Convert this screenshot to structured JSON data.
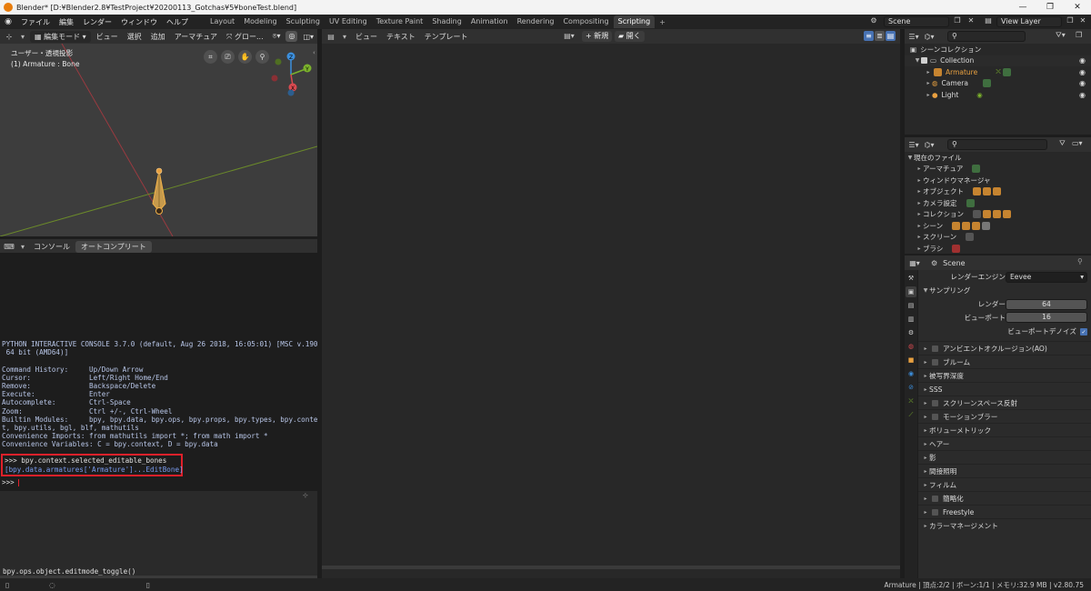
{
  "window": {
    "title": "Blender* [D:¥Blender2.8¥TestProject¥20200113_Gotchas¥5¥boneTest.blend]",
    "minimize": "—",
    "maximize": "❐",
    "close": "✕"
  },
  "menu": {
    "items": [
      "ファイル",
      "編集",
      "レンダー",
      "ウィンドウ",
      "ヘルプ"
    ],
    "workspaces": [
      "Layout",
      "Modeling",
      "Sculpting",
      "UV Editing",
      "Texture Paint",
      "Shading",
      "Animation",
      "Rendering",
      "Compositing",
      "Scripting"
    ],
    "active_workspace": "Scripting",
    "add_tab": "+",
    "scene": "Scene",
    "view_layer": "View Layer"
  },
  "viewport": {
    "mode": "編集モード",
    "menus": [
      "ビュー",
      "選択",
      "追加",
      "アーマチュア"
    ],
    "transform": "グロー...",
    "overlay_line1": "ユーザー・透視投影",
    "overlay_line2": "(1) Armature : Bone",
    "gizmo": {
      "z": "Z",
      "y": "Y",
      "x": "X"
    }
  },
  "console": {
    "tabs": [
      "コンソール",
      "オートコンプリート"
    ],
    "active_tab": "オートコンプリート",
    "banner": [
      "PYTHON INTERACTIVE CONSOLE 3.7.0 (default, Aug 26 2018, 16:05:01) [MSC v.1900",
      " 64 bit (AMD64)]",
      "",
      "Command History:     Up/Down Arrow",
      "Cursor:              Left/Right Home/End",
      "Remove:              Backspace/Delete",
      "Execute:             Enter",
      "Autocomplete:        Ctrl-Space",
      "Zoom:                Ctrl +/-, Ctrl-Wheel",
      "Builtin Modules:     bpy, bpy.data, bpy.ops, bpy.props, bpy.types, bpy.contex",
      "t, bpy.utils, bgl, blf, mathutils",
      "Convenience Imports: from mathutils import *; from math import *",
      "Convenience Variables: C = bpy.context, D = bpy.data"
    ],
    "command": ">>> bpy.context.selected_editable_bones",
    "output": "[bpy.data.armatures['Armature']...EditBone]",
    "prompt": ">>> ",
    "info_log": "bpy.ops.object.editmode_toggle()"
  },
  "text_editor": {
    "menus": [
      "ビュー",
      "テキスト",
      "テンプレート"
    ],
    "new_label": "新規",
    "open_label": "開く"
  },
  "outliner": {
    "root": "シーンコレクション",
    "collection": "Collection",
    "objects": [
      "Armature",
      "Camera",
      "Light"
    ]
  },
  "file_browser": {
    "root": "現在のファイル",
    "items": [
      "アーマチュア",
      "ウィンドウマネージャ",
      "オブジェクト",
      "カメラ設定",
      "コレクション",
      "シーン",
      "スクリーン",
      "ブラシ"
    ]
  },
  "properties": {
    "context": "Scene",
    "render_engine_label": "レンダーエンジン",
    "render_engine_value": "Eevee",
    "sampling_label": "サンプリング",
    "render_label": "レンダー",
    "render_value": "64",
    "viewport_label": "ビューポート",
    "viewport_value": "16",
    "denoise_label": "ビューポートデノイズ",
    "sections": [
      {
        "label": "アンビエントオクルージョン(AO)",
        "checkbox": true
      },
      {
        "label": "ブルーム",
        "checkbox": true
      },
      {
        "label": "被写界深度",
        "checkbox": false
      },
      {
        "label": "SSS",
        "checkbox": false
      },
      {
        "label": "スクリーンスペース反射",
        "checkbox": true
      },
      {
        "label": "モーションブラー",
        "checkbox": true
      },
      {
        "label": "ボリューメトリック",
        "checkbox": false
      },
      {
        "label": "ヘアー",
        "checkbox": false
      },
      {
        "label": "影",
        "checkbox": false
      },
      {
        "label": "間接照明",
        "checkbox": false
      },
      {
        "label": "フィルム",
        "checkbox": false
      },
      {
        "label": "簡略化",
        "checkbox": true
      },
      {
        "label": "Freestyle",
        "checkbox": true
      },
      {
        "label": "カラーマネージメント",
        "checkbox": false
      }
    ]
  },
  "status": {
    "text": "Armature | 頂点:2/2 | ボーン:1/1 | メモリ:32.9 MB | v2.80.75"
  },
  "colors": {
    "accent_blue": "#4772b3",
    "highlight_red": "#e0202a",
    "armature_orange": "#e8a040",
    "x_axis": "#d94a50",
    "y_axis": "#7bb22c",
    "z_axis": "#3c8fdd"
  }
}
